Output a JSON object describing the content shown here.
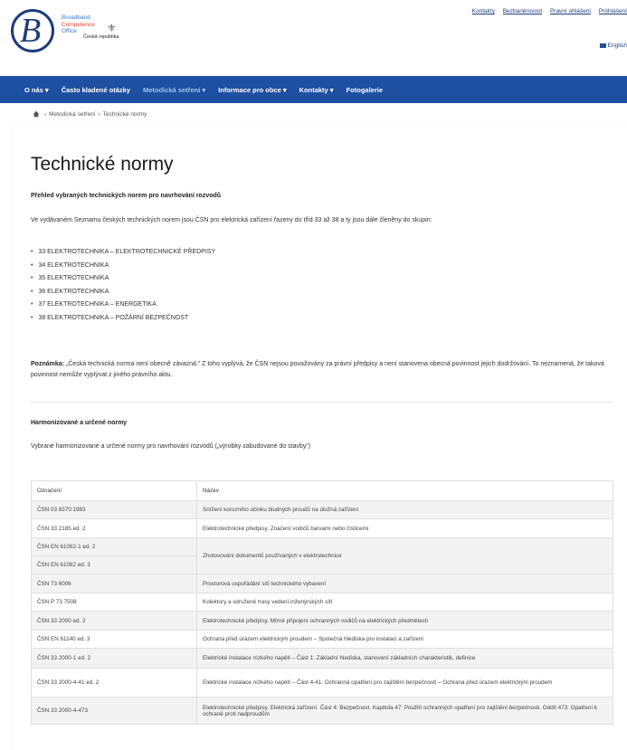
{
  "header": {
    "logo": {
      "letter": "B",
      "line1": "Broadband",
      "line2": "Competence",
      "line3": "Office",
      "country": "Česká republika"
    },
    "top_links": [
      "Kontakty",
      "Bezbariérovost",
      "Pravní ohlášení",
      "Prohlášení"
    ],
    "language": "English"
  },
  "nav": {
    "items": [
      "O nás ▾",
      "Často kladené otázky",
      "Metodická setření ▾",
      "Informace pro obce ▾",
      "Kontakty ▾",
      "Fotogalerie"
    ]
  },
  "breadcrumb": {
    "home_icon": "home-icon",
    "items": [
      "Metodická setření",
      "Technické normy"
    ]
  },
  "page": {
    "title": "Technické normy",
    "subtitle": "Přehled vybraných technických norem pro navrhování rozvodů",
    "intro": "Ve vydávaném Seznamu českých technických norem jsou ČSN pro elektrická zařízení řazeny do tříd 33 až 38 a ty jsou dále členěny do skupin:",
    "list": [
      "33 ELEKTROTECHNIKA – ELEKTROTECHNICKÉ PŘEDPISY",
      "34 ELEKTROTECHNIKA",
      "35 ELEKTROTECHNIKA",
      "36 ELEKTROTECHNIKA",
      "37 ELEKTROTECHNIKA – ENERGETIKA",
      "38 ELEKTROTECHNIKA – POŽÁRNÍ BEZPEČNOST"
    ],
    "note_label": "Poznámka:",
    "note_text": "„Česká technická norma není obecně závazná.“ Z toho vyplývá, že ČSN nejsou považovány za právní předpisy a není stanovena obecná povinnost jejich dodržování. To neznamená, že taková povinnost nemůže vyplývat z jiného právního aktu.",
    "section_title": "Harmonizované a určené normy",
    "section_intro": "Vybrané harmonizované a určené normy pro navrhování rozvodů („výrobky zabudované do stavby“)"
  },
  "table": {
    "headers": [
      "Označení",
      "Název"
    ],
    "rows": [
      {
        "code": "ČSN 03 8370:1983",
        "name": "Snížení korozního účinku bludných proudů na úložná zařízení"
      },
      {
        "code": "ČSN 33 2185 ed. 2",
        "name": "Elektrotechnické předpisy. Značení vodičů barvami nebo číslicemi"
      },
      {
        "code": "ČSN EN 61082-1 ed. 2",
        "name": "Zhotovování dokumentů používaných v elektrotechnice"
      },
      {
        "code": "ČSN EN 61082 ed. 3",
        "name": ""
      },
      {
        "code": "ČSN 73 6006",
        "name": "Prostorová uspořádání sítí technického vybavení"
      },
      {
        "code": "ČSN P 73 7508",
        "name": "Kolektory a sdružené trasy vedení inženýrských sítí"
      },
      {
        "code": "ČSN 33 2000 ed. 2",
        "name": "Elektrotechnické předpisy. Mírné připojení ochranných vodičů na elektrických předmětech"
      },
      {
        "code": "ČSN EN 61140 ed. 3",
        "name": "Ochrana před úrazem elektrickým proudem – Společná hlediska pro instalaci a zařízení"
      },
      {
        "code": "ČSN 33 2000-1 ed. 2",
        "name": "Elektrické instalace nízkého napětí – Část 1: Základní hlediska, stanovení základních charakteristik, definice"
      },
      {
        "code": "ČSN 33 2000-4-41 ed. 2",
        "name": "Elektrické instalace nízkého napětí – Část 4-41: Ochranná opatření pro zajištění bezpečnosti – Ochrana před úrazem elektrickým proudem"
      },
      {
        "code": "ČSN 33 2000-4-473",
        "name": "Elektrotechnické předpisy. Elektrická zařízení. Část 4: Bezpečnost. Kapitola 47: Použití ochranných opatření pro zajištění bezpečnosti. Oddíl 473: Opatření k ochraně proti nadproudům"
      }
    ]
  }
}
